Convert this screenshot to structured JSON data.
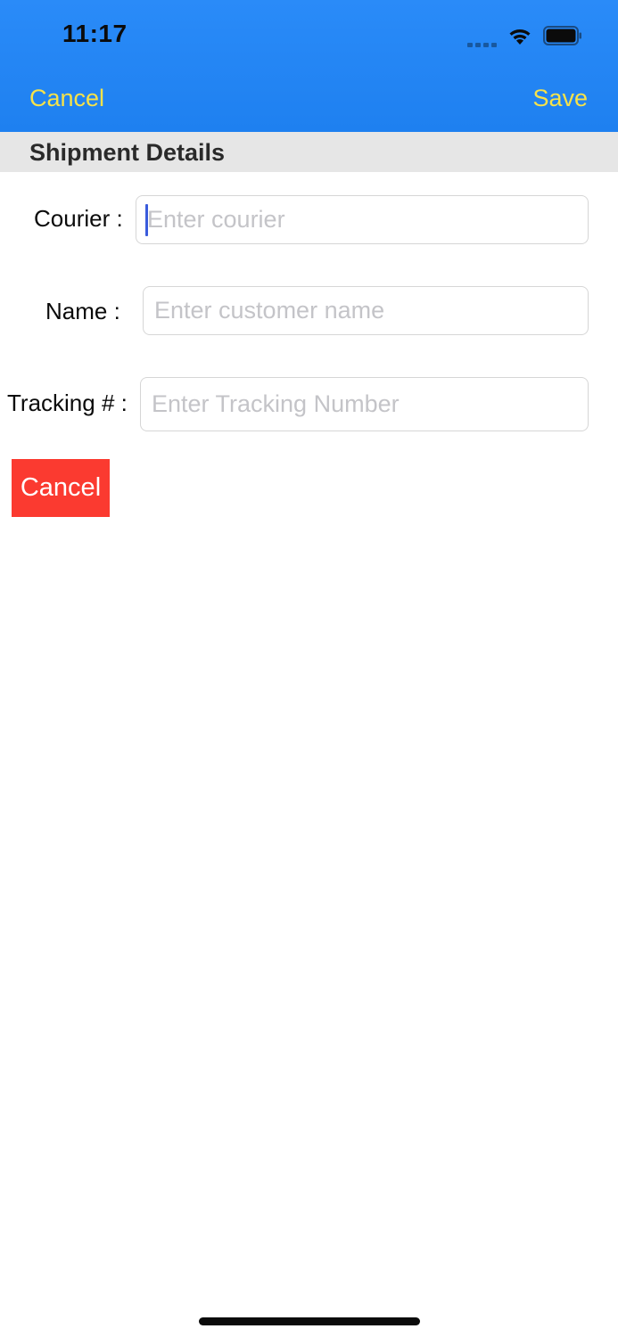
{
  "status_bar": {
    "time": "11:17"
  },
  "nav_bar": {
    "cancel_label": "Cancel",
    "save_label": "Save",
    "accent_color": "#f6e24a",
    "background_color": "#1e80f0"
  },
  "section": {
    "title": "Shipment Details"
  },
  "form": {
    "courier": {
      "label": "Courier :",
      "value": "",
      "placeholder": "Enter courier"
    },
    "name": {
      "label": "Name :",
      "value": "",
      "placeholder": "Enter customer name"
    },
    "tracking": {
      "label": "Tracking # :",
      "value": "",
      "placeholder": "Enter Tracking Number"
    }
  },
  "cancel_button": {
    "label": "Cancel",
    "color": "#fb3a30"
  },
  "icons": {
    "signal": "cellular-signal-icon",
    "wifi": "wifi-icon",
    "battery": "battery-icon"
  }
}
